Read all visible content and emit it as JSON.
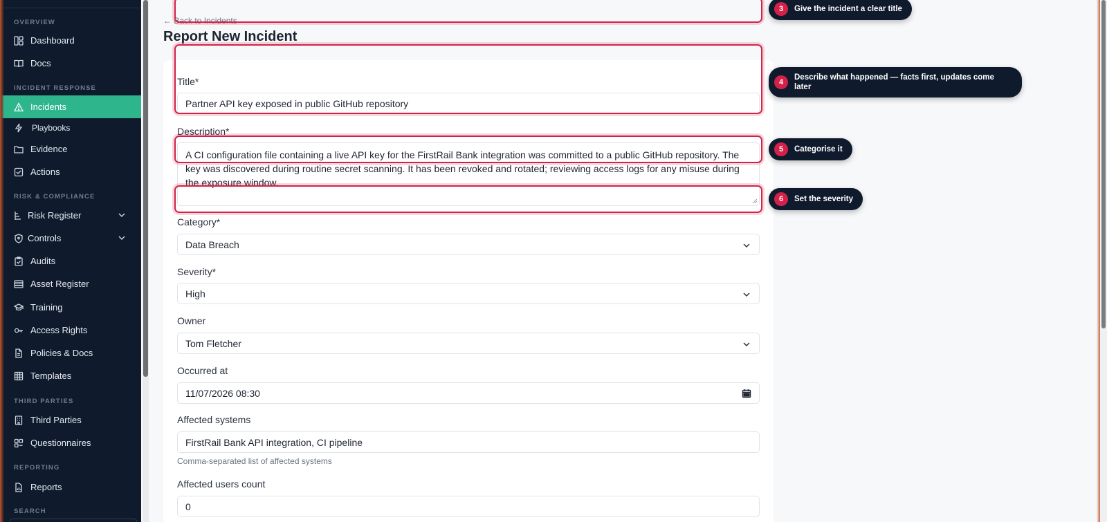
{
  "sidebar": {
    "sections": {
      "overview": "OVERVIEW",
      "incident_response": "INCIDENT RESPONSE",
      "risk_compliance": "RISK & COMPLIANCE",
      "third_parties": "THIRD PARTIES",
      "reporting": "REPORTING",
      "search": "SEARCH"
    },
    "items": {
      "dashboard": "Dashboard",
      "docs": "Docs",
      "incidents": "Incidents",
      "playbooks": "Playbooks",
      "evidence": "Evidence",
      "actions": "Actions",
      "risk_register": "Risk Register",
      "controls": "Controls",
      "audits": "Audits",
      "asset_register": "Asset Register",
      "training": "Training",
      "access_rights": "Access Rights",
      "policies_docs": "Policies & Docs",
      "templates": "Templates",
      "third_parties": "Third Parties",
      "questionnaires": "Questionnaires",
      "reports": "Reports"
    }
  },
  "page": {
    "back_link": "← Back to Incidents",
    "title": "Report New Incident"
  },
  "form": {
    "title_label": "Title*",
    "title_value": "Partner API key exposed in public GitHub repository",
    "description_label": "Description*",
    "description_value": "A CI configuration file containing a live API key for the FirstRail Bank integration was committed to a public GitHub repository. The key was discovered during routine secret scanning. It has been revoked and rotated; reviewing access logs for any misuse during the exposure window.",
    "category_label": "Category*",
    "category_value": "Data Breach",
    "severity_label": "Severity*",
    "severity_value": "High",
    "owner_label": "Owner",
    "owner_value": "Tom Fletcher",
    "occurred_label": "Occurred at",
    "occurred_value": "11/07/2026 08:30",
    "affected_systems_label": "Affected systems",
    "affected_systems_value": "FirstRail Bank API integration, CI pipeline",
    "affected_systems_hint": "Comma-separated list of affected systems",
    "affected_users_label": "Affected users count",
    "affected_users_value": "0"
  },
  "callouts": {
    "c3": {
      "num": "3",
      "pre": "Give the incident a ",
      "bold": "clear title",
      "post": ""
    },
    "c4": {
      "num": "4",
      "pre": "Describe ",
      "bold": "what happened",
      "post": " — facts first, updates come later"
    },
    "c5": {
      "num": "5",
      "pre": "Categorise it",
      "bold": "",
      "post": ""
    },
    "c6": {
      "num": "6",
      "pre": "Set the ",
      "bold": "severity",
      "post": ""
    }
  },
  "colors": {
    "sidebar_bg": "#0f1b2d",
    "active_nav": "#2fb58c",
    "highlight": "#d4214a",
    "callout_bg": "#0f1b2d"
  }
}
